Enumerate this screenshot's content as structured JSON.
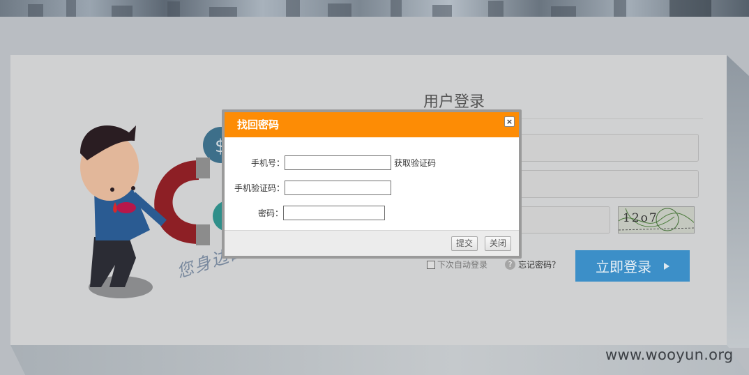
{
  "login": {
    "title": "用户登录",
    "remember_label": "下次自动登录",
    "forgot_label": "忘记密码？",
    "help_glyph": "?",
    "submit_label": "立即登录",
    "captcha_text": "12o7"
  },
  "slogan": "您身边的财富专家!",
  "dialog": {
    "title": "找回密码",
    "close_glyph": "×",
    "phone_label": "手机号：",
    "phone_value": "",
    "get_code_label": "获取验证码",
    "code_label": "手机验证码：",
    "code_value": "",
    "password_label": "密码：",
    "password_value": "",
    "submit_label": "提交",
    "close_label": "关闭"
  },
  "watermark": "www.wooyun.org",
  "colors": {
    "dialog_header": "#fd8c05",
    "login_button": "#3c8fc8"
  }
}
